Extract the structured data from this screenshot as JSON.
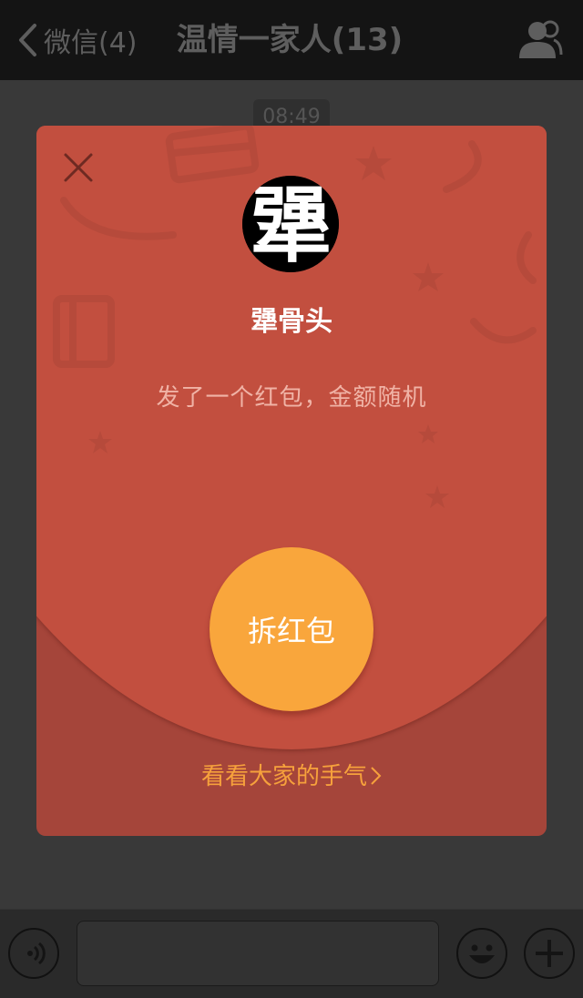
{
  "header": {
    "back_label": "微信(4)",
    "title": "温情一家人(13)",
    "icons": {
      "back": "chevron-left-icon",
      "contacts": "group-contacts-icon"
    }
  },
  "chat": {
    "timestamp": "08:49"
  },
  "red_packet": {
    "close_icon": "close-icon",
    "avatar_glyph": "犟",
    "sender_name": "犟骨头",
    "greeting": "发了一个红包，金额随机",
    "open_button_label": "拆红包",
    "luck_link_label": "看看大家的手气",
    "colors": {
      "top": "#c24f3f",
      "bottom": "#a5453a",
      "button": "#f9a63c",
      "link": "#f6a13c"
    }
  },
  "input_bar": {
    "icons": {
      "voice": "voice-icon",
      "emoji": "emoji-icon",
      "plus": "plus-icon"
    }
  }
}
